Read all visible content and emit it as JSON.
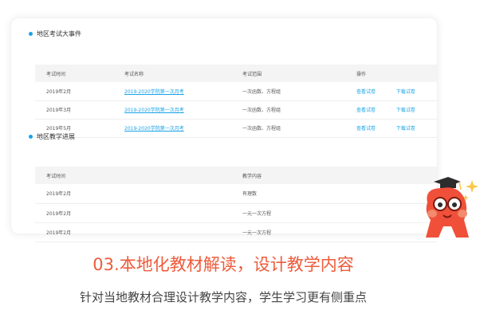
{
  "exam_section": {
    "title": "地区考试大事件",
    "headers": [
      "考试时间",
      "考试名称",
      "考试范围",
      "操作"
    ],
    "rows": [
      {
        "date": "2019年2月",
        "name": "2019-2020学院第一次月考",
        "scope": "一次函数、方程组",
        "view": "查看试卷",
        "download": "下载试卷"
      },
      {
        "date": "2019年3月",
        "name": "2019-2020学院第一次月考",
        "scope": "一次函数、方程组",
        "view": "查看试卷",
        "download": "下载试卷"
      },
      {
        "date": "2019年5月",
        "name": "2019-2020学院第一次月考",
        "scope": "一次函数、方程组",
        "view": "查看试卷",
        "download": "下载试卷"
      }
    ]
  },
  "teaching_section": {
    "title": "地区教学进展",
    "headers": [
      "考试时间",
      "教学内容"
    ],
    "rows": [
      {
        "date": "2019年2月",
        "content": "有理数"
      },
      {
        "date": "2019年2月",
        "content": "一元一次方程"
      },
      {
        "date": "2019年2月",
        "content": "一元一次方程"
      }
    ]
  },
  "feature": {
    "headline": "03.本地化教材解读，设计教学内容",
    "subline": "针对当地教材合理设计教学内容，学生学习更有侧重点"
  },
  "colors": {
    "accent": "#1aa3e8",
    "headline": "#ee5b3b",
    "mascot": "#f0503a"
  },
  "icons": {
    "mascot": "graduate-mascot-icon",
    "sparkle": "sparkle-icon"
  }
}
